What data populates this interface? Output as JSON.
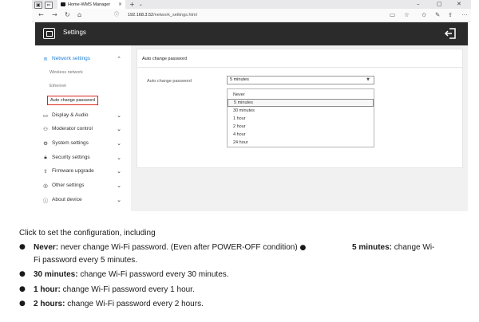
{
  "browser": {
    "tab_title": "Home-WMS Manager",
    "tab_close": "×",
    "new_tab": "+",
    "tab_menu": "⌄",
    "url_host": "192.168.3.52",
    "url_path": "/network_settings.html",
    "win_minimize": "–",
    "win_restore": "▢",
    "win_close": "✕"
  },
  "app": {
    "title": "Settings"
  },
  "sidebar": {
    "network_settings": "Network settings",
    "sub_items": [
      "Wireless network",
      "Ethernet",
      "Auto change password"
    ],
    "items": [
      {
        "label": "Display & Audio",
        "icon": "monitor-icon"
      },
      {
        "label": "Moderator control",
        "icon": "moderator-icon"
      },
      {
        "label": "System settings",
        "icon": "gear-icon"
      },
      {
        "label": "Security settings",
        "icon": "lock-icon"
      },
      {
        "label": "Firmware upgrade",
        "icon": "upload-icon"
      },
      {
        "label": "Other settings",
        "icon": "other-icon"
      },
      {
        "label": "About device",
        "icon": "info-icon"
      }
    ]
  },
  "panel": {
    "title": "Auto change password",
    "field_label": "Auto change password",
    "selected_value": "5 minutes",
    "options": [
      "Never",
      "5 minutes",
      "30 minutes",
      "1 hour",
      "2 hour",
      "4 hour",
      "24 hour"
    ]
  },
  "doc": {
    "intro": "Click to set the configuration, including",
    "b1_term": "Never:",
    "b1_text": " never change Wi-Fi password. (Even after POWER-OFF condition)",
    "b1_sep": "●",
    "b2_term": "5 minutes:",
    "b2_text": " change Wi-",
    "b2_cont": "Fi password every 5 minutes.",
    "b3_term": "30 minutes:",
    "b3_text": " change Wi-Fi password every 30 minutes.",
    "b4_term": "1 hour:",
    "b4_text": " change Wi-Fi password every 1 hour.",
    "b5_term": "2 hours:",
    "b5_text": " change Wi-Fi password every 2 hours.",
    "bullet": "●"
  }
}
